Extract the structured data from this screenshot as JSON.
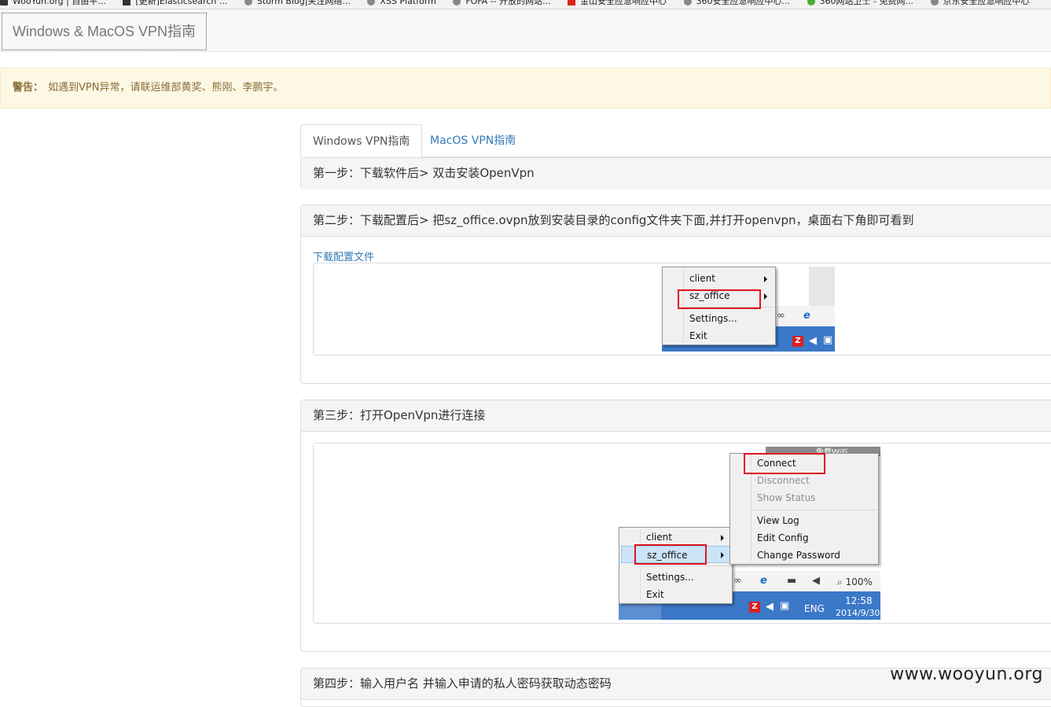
{
  "bookmarks": [
    {
      "label": "WooYun.org | 自由平...",
      "icon": "dark"
    },
    {
      "label": "[更新]Elasticsearch ...",
      "icon": "dark"
    },
    {
      "label": "Storm Blog|关注网络...",
      "icon": "gray"
    },
    {
      "label": "XSS Platform",
      "icon": "gray"
    },
    {
      "label": "FOFA -- 开放的网站...",
      "icon": "gray"
    },
    {
      "label": "金山安全应急响应中心",
      "icon": "red"
    },
    {
      "label": "360安全应急响应中心...",
      "icon": "gray"
    },
    {
      "label": "360网站卫士 - 免费网...",
      "icon": "green"
    },
    {
      "label": "京东安全应急响应中心",
      "icon": "gray"
    }
  ],
  "navbar": {
    "brand": "Windows & MacOS VPN指南"
  },
  "alert": {
    "label": "警告：",
    "text": "如遇到VPN异常，请联运维部黄奖、熊刚、李鹏宇。"
  },
  "tabs": [
    {
      "label": "Windows VPN指南",
      "active": true
    },
    {
      "label": "MacOS VPN指南",
      "active": false
    }
  ],
  "steps": {
    "step1": {
      "title": "第一步：下载软件后> 双击安装OpenVpn"
    },
    "step2": {
      "title": "第二步：下载配置后> 把sz_office.ovpn放到安装目录的config文件夹下面,并打开openvpn，桌面右下角即可看到",
      "link": "下载配置文件"
    },
    "step3": {
      "title": "第三步：打开OpenVpn进行连接"
    },
    "step4": {
      "title": "第四步：输入用户名 并输入申请的私人密码获取动态密码"
    }
  },
  "menu1": {
    "items": [
      "client",
      "sz_office",
      "Settings...",
      "Exit"
    ]
  },
  "menu2": {
    "items": [
      "client",
      "sz_office",
      "Settings...",
      "Exit"
    ]
  },
  "submenu": {
    "items": [
      "Connect",
      "Disconnect",
      "Show Status",
      "View Log",
      "Edit Config",
      "Change Password"
    ]
  },
  "tray": {
    "lang": "ENG",
    "time": "12:58",
    "date": "2014/9/30",
    "zoom": "100%",
    "wifi": "免费WiFi"
  },
  "watermark": "www.wooyun.org",
  "colors": {
    "accent": "#337ab7",
    "warning_bg": "#fcf8e3",
    "warning_text": "#8a6d3b",
    "highlight_box": "#e0141e",
    "taskbar": "#3b78c8"
  }
}
